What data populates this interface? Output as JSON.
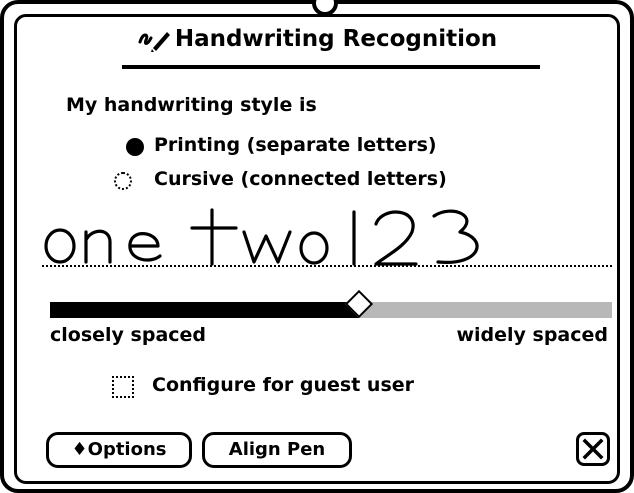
{
  "dialog": {
    "title": "Handwriting Recognition",
    "style_prompt": "My handwriting style is",
    "options": [
      {
        "label": "Printing (separate letters)",
        "selected": true
      },
      {
        "label": "Cursive (connected letters)",
        "selected": false
      }
    ],
    "sample_text": "one two 123",
    "spacing": {
      "left_label": "closely spaced",
      "right_label": "widely spaced",
      "level_fraction": 0.55
    },
    "guest_user_label": "Configure for guest user",
    "guest_user_checked": false,
    "buttons": {
      "options": "♦Options",
      "align_pen": "Align Pen"
    }
  }
}
